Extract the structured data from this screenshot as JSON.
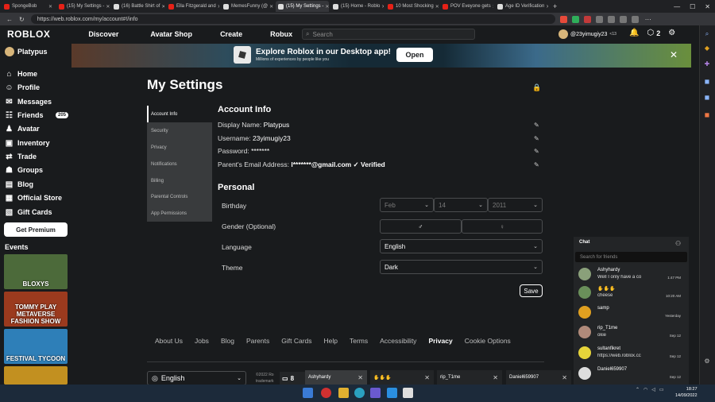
{
  "browser": {
    "tabs": [
      {
        "label": "SpongeBob",
        "color": "#e62117"
      },
      {
        "label": "(15) My Settings -",
        "color": "#e62117"
      },
      {
        "label": "(16) Battle Shirt of",
        "color": "#dddddd"
      },
      {
        "label": "Ella Fitzgerald and",
        "color": "#e62117"
      },
      {
        "label": "MemesFunny (@",
        "color": "#dddddd"
      },
      {
        "label": "(15) My Settings -",
        "color": "#dddddd",
        "active": true
      },
      {
        "label": "(15) Home - Roblo",
        "color": "#dddddd"
      },
      {
        "label": "10 Most Shocking",
        "color": "#e62117"
      },
      {
        "label": "POV Eveyone gets",
        "color": "#e62117"
      },
      {
        "label": "Age ID Verification",
        "color": "#dddddd"
      }
    ],
    "url": "https://web.roblox.com/my/account#!/info"
  },
  "header": {
    "logo": "ROBLOX",
    "nav": [
      "Discover",
      "Avatar Shop",
      "Create",
      "Robux"
    ],
    "search_placeholder": "Search",
    "user": "@23yimugiy23",
    "user_suffix": "<13",
    "robux": "2"
  },
  "sidebar": {
    "username": "Platypus",
    "items": [
      {
        "label": "Home",
        "icon": "⌂"
      },
      {
        "label": "Profile",
        "icon": "☺"
      },
      {
        "label": "Messages",
        "icon": "✉"
      },
      {
        "label": "Friends",
        "icon": "☷",
        "badge": "205"
      },
      {
        "label": "Avatar",
        "icon": "♟"
      },
      {
        "label": "Inventory",
        "icon": "▣"
      },
      {
        "label": "Trade",
        "icon": "⇄"
      },
      {
        "label": "Groups",
        "icon": "☗"
      },
      {
        "label": "Blog",
        "icon": "▤"
      },
      {
        "label": "Official Store",
        "icon": "▦"
      },
      {
        "label": "Gift Cards",
        "icon": "▧"
      }
    ],
    "premium": "Get Premium",
    "events_title": "Events",
    "events": [
      {
        "label": "BLOXYS",
        "bg": "#4c6a3a"
      },
      {
        "label": "TOMMY PLAY METAVERSE FASHION SHOW",
        "bg": "#9b3a1e"
      },
      {
        "label": "FESTIVAL TYCOON",
        "bg": "#2e7fb8"
      },
      {
        "label": "",
        "bg": "#c29020"
      }
    ]
  },
  "banner": {
    "title": "Explore Roblox in our Desktop app!",
    "subtitle": "Millions of experiences by people like you",
    "open": "Open"
  },
  "settings": {
    "title": "My Settings",
    "tabs": [
      "Account Info",
      "Security",
      "Privacy",
      "Notifications",
      "Billing",
      "Parental Controls",
      "App Permissions"
    ],
    "account_info": {
      "title": "Account Info",
      "rows": [
        {
          "label": "Display Name:",
          "value": "Platypus"
        },
        {
          "label": "Username:",
          "value": "23yimugiy23"
        },
        {
          "label": "Password:",
          "value": "*******"
        },
        {
          "label": "Parent's Email Address:",
          "value": "l*******@gmail.com ✓ Verified"
        }
      ]
    },
    "personal": {
      "title": "Personal",
      "birthday_label": "Birthday",
      "birthday": {
        "month": "Feb",
        "day": "14",
        "year": "2011"
      },
      "gender_label": "Gender (Optional)",
      "language_label": "Language",
      "language": "English",
      "theme_label": "Theme",
      "theme": "Dark",
      "save": "Save"
    }
  },
  "footer": {
    "links": [
      "About Us",
      "Jobs",
      "Blog",
      "Parents",
      "Gift Cards",
      "Help",
      "Terms",
      "Accessibility",
      "Privacy",
      "Cookie Options"
    ],
    "language": "English",
    "copyright": "©2022 Ro trademark"
  },
  "chat": {
    "title": "Chat",
    "search_placeholder": "Search for friends",
    "conversations": [
      {
        "name": "Ashyhardy",
        "message": "Well I only have a co",
        "time": "1:47 PM",
        "color": "#8aa07a"
      },
      {
        "name": "✋✋✋",
        "message": "cheese",
        "time": "10:20 AM",
        "color": "#6a8f5a"
      },
      {
        "name": "samp",
        "message": "",
        "time": "Yesterday",
        "color": "#e0a020"
      },
      {
        "name": "rip_T1me",
        "message": "okie",
        "time": "Sep 12",
        "color": "#b08a7a"
      },
      {
        "name": "sultanfikret",
        "message": "https://web.roblox.cc",
        "time": "Sep 12",
        "color": "#e6d43a"
      },
      {
        "name": "Daniel659907",
        "message": "",
        "time": "Sep 12",
        "color": "#dddddd"
      }
    ],
    "count": "8",
    "open_chats": [
      {
        "name": "Ashyhardy"
      },
      {
        "name": "✋✋✋"
      },
      {
        "name": "rip_T1me"
      },
      {
        "name": "Daniel659907"
      }
    ]
  },
  "taskbar": {
    "time": "18:27",
    "date": "14/09/2022"
  }
}
